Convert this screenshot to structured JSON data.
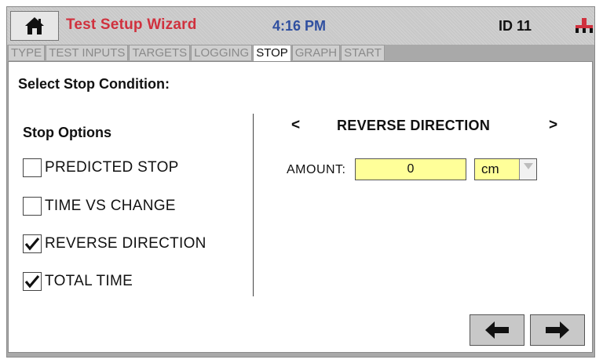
{
  "header": {
    "title": "Test Setup Wizard",
    "time": "4:16 PM",
    "id_label": "ID 11",
    "icons": [
      "home-icon",
      "network-icon"
    ],
    "title_color": "#d0313e",
    "time_color": "#2f4fa0"
  },
  "tabs": [
    {
      "label": "TYPE",
      "active": false
    },
    {
      "label": "TEST INPUTS",
      "active": false
    },
    {
      "label": "TARGETS",
      "active": false
    },
    {
      "label": "LOGGING",
      "active": false
    },
    {
      "label": "STOP",
      "active": true
    },
    {
      "label": "GRAPH",
      "active": false
    },
    {
      "label": "START",
      "active": false
    }
  ],
  "panel": {
    "heading": "Select Stop Condition:",
    "options_title": "Stop Options",
    "options": [
      {
        "label": "PREDICTED STOP",
        "checked": false
      },
      {
        "label": "TIME VS CHANGE",
        "checked": false
      },
      {
        "label": "REVERSE DIRECTION",
        "checked": true
      },
      {
        "label": "TOTAL TIME",
        "checked": true
      }
    ],
    "condition_nav": {
      "prev": "<",
      "title": "REVERSE DIRECTION",
      "next": ">"
    },
    "amount": {
      "label": "AMOUNT:",
      "value": "0",
      "unit": "cm"
    }
  },
  "footer": {
    "icons": [
      "arrow-left-icon",
      "arrow-right-icon"
    ]
  }
}
